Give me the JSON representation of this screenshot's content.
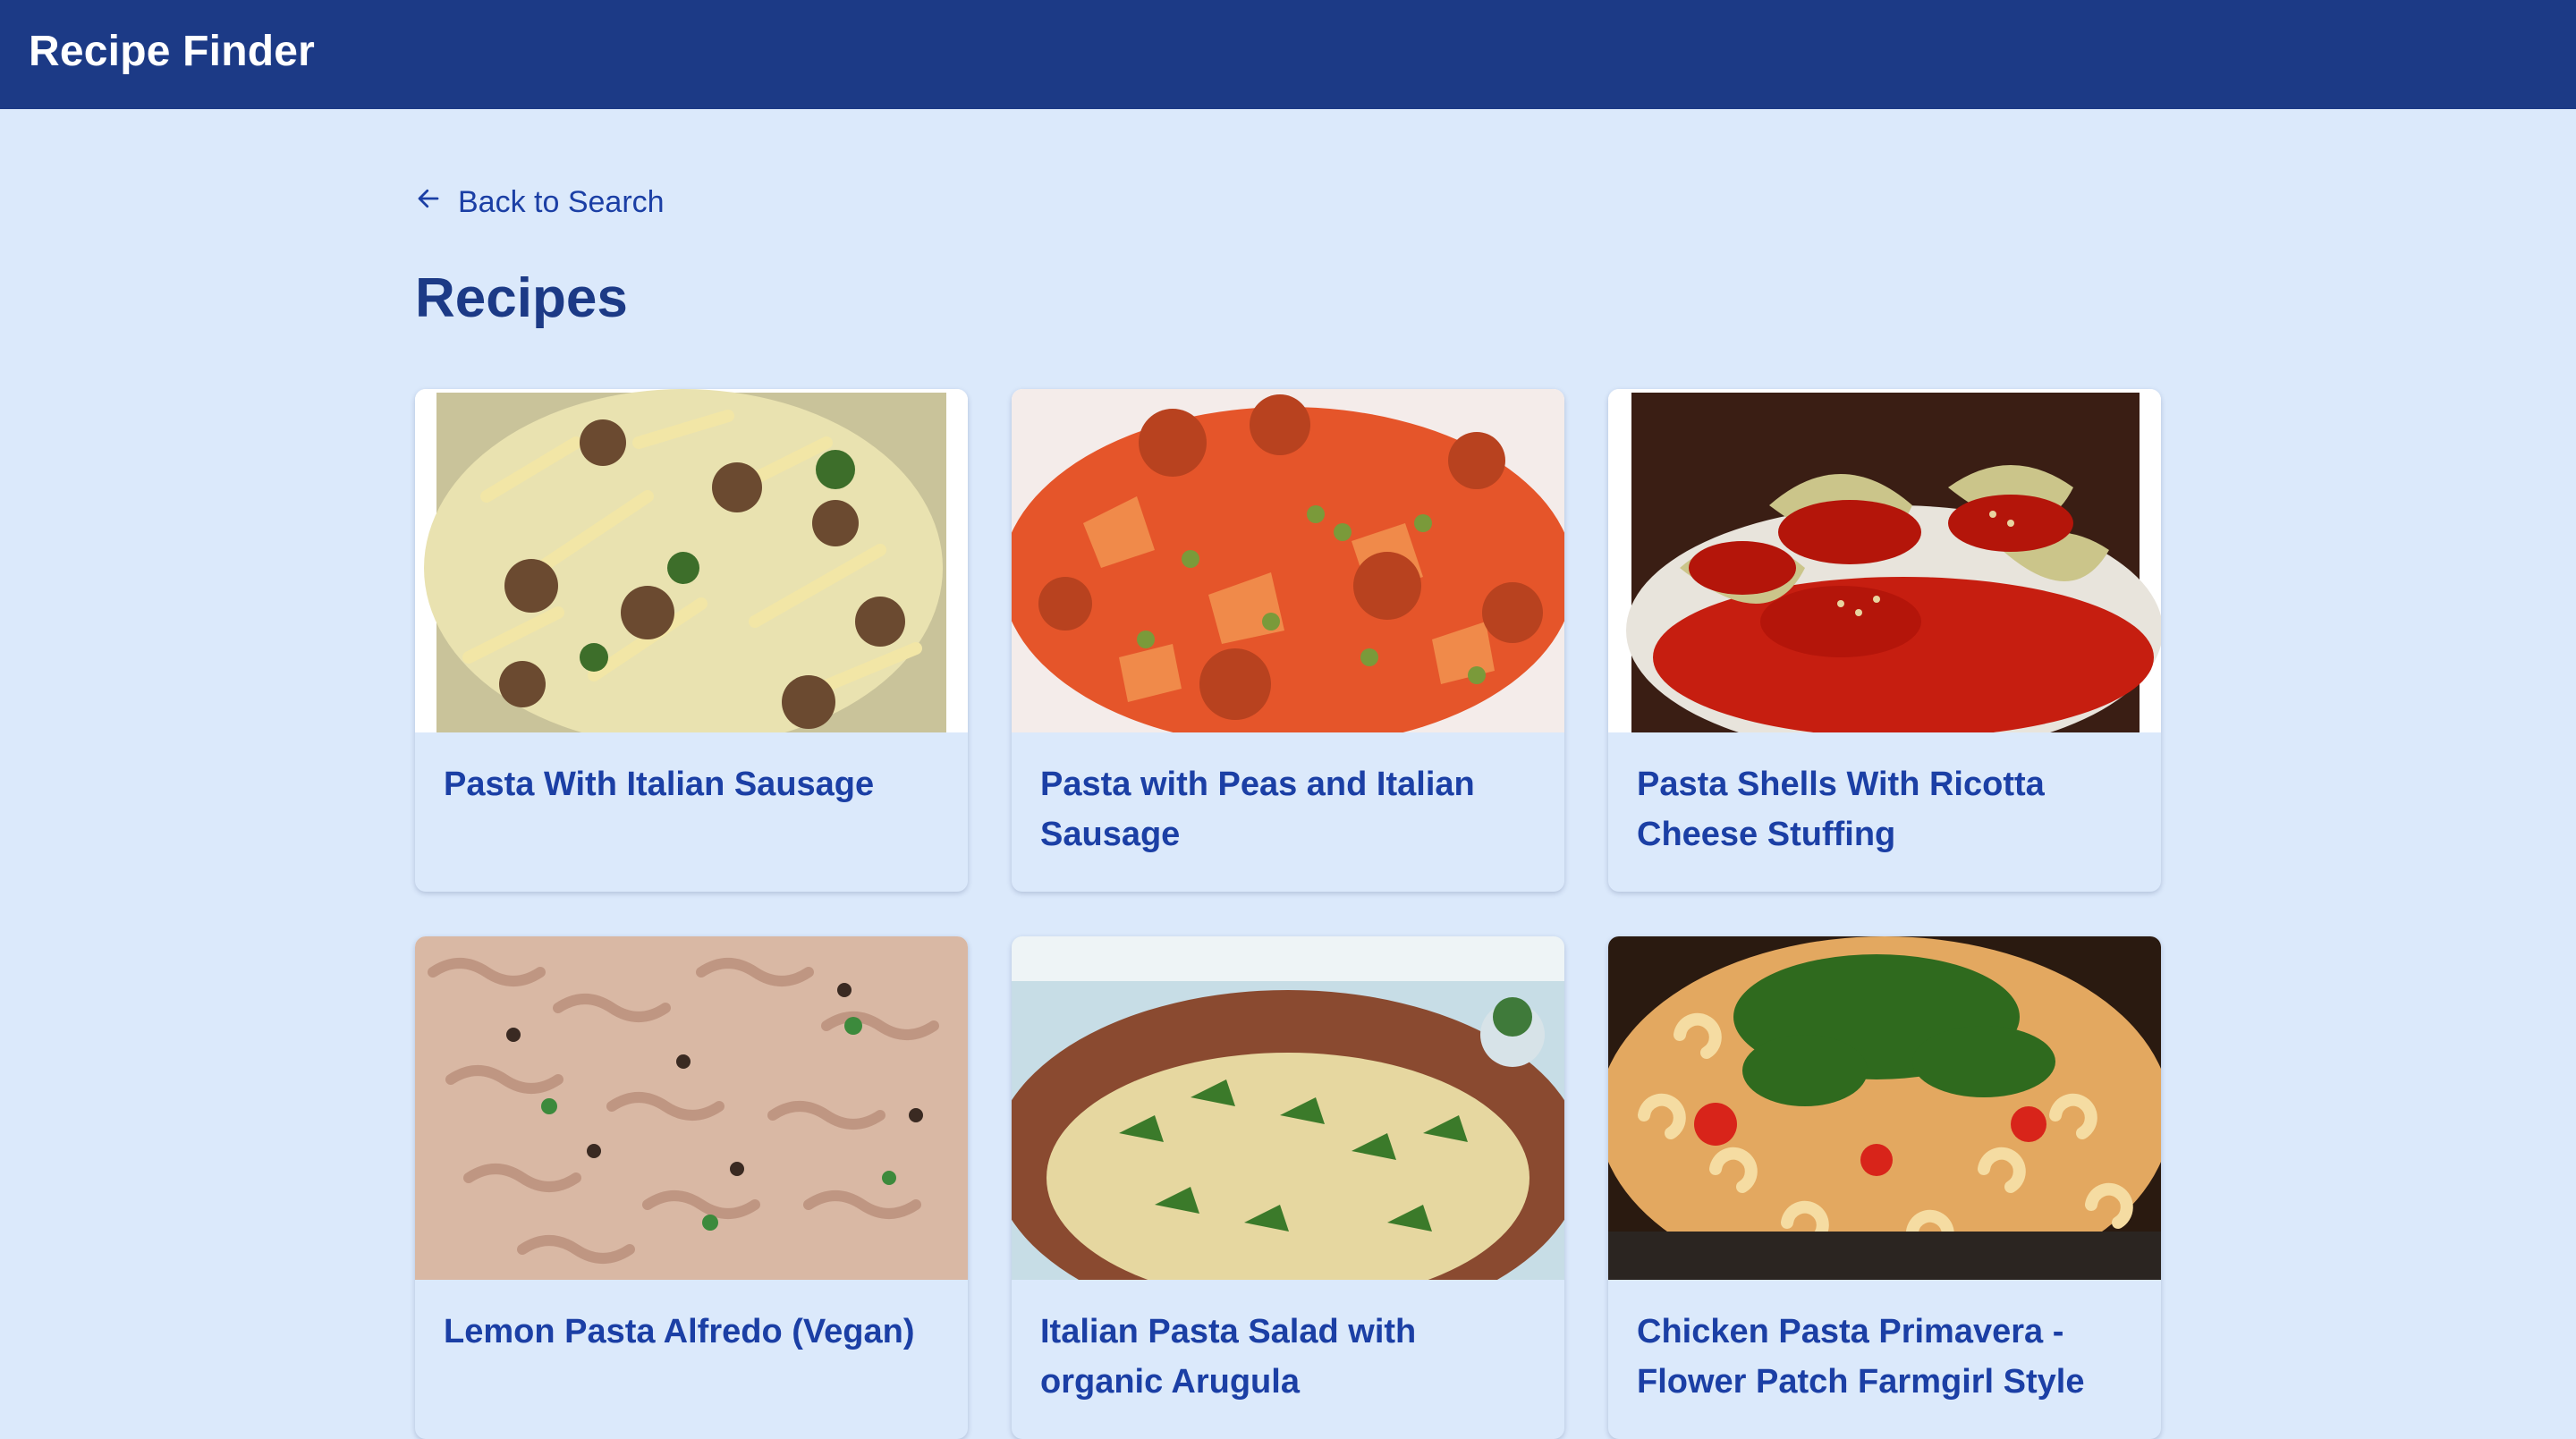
{
  "header": {
    "app_title": "Recipe Finder"
  },
  "nav": {
    "back_label": "Back to Search",
    "back_icon": "arrow-left-icon"
  },
  "main": {
    "title": "Recipes",
    "recipes": [
      {
        "title": "Pasta With Italian Sausage"
      },
      {
        "title": "Pasta with Peas and Italian Sausage"
      },
      {
        "title": "Pasta Shells With Ricotta Cheese Stuffing"
      },
      {
        "title": "Lemon Pasta Alfredo (Vegan)"
      },
      {
        "title": "Italian Pasta Salad with organic Arugula"
      },
      {
        "title": "Chicken Pasta Primavera - Flower Patch Farmgirl Style"
      }
    ]
  },
  "colors": {
    "header_bg": "#1c3a86",
    "page_bg": "#dbe9fb",
    "link": "#1b3fa5",
    "heading": "#1c3a86"
  }
}
